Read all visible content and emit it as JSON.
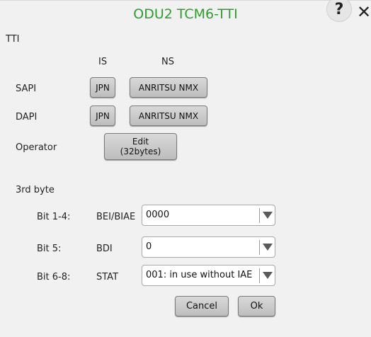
{
  "dialog": {
    "title": "ODU2 TCM6-TTI",
    "help_icon": "question-mark",
    "close_icon": "x"
  },
  "tti": {
    "section_label": "TTI",
    "col_is": "IS",
    "col_ns": "NS",
    "sapi": {
      "label": "SAPI",
      "is_value": "JPN",
      "ns_value": "ANRITSU NMX"
    },
    "dapi": {
      "label": "DAPI",
      "is_value": "JPN",
      "ns_value": "ANRITSU NMX"
    },
    "operator": {
      "label": "Operator",
      "button_line1": "Edit",
      "button_line2": "(32bytes)"
    }
  },
  "third_byte": {
    "section_label": "3rd byte",
    "rows": [
      {
        "bits": "Bit 1-4:",
        "name": "BEI/BIAE",
        "value": "0000"
      },
      {
        "bits": "Bit 5:",
        "name": "BDI",
        "value": "0"
      },
      {
        "bits": "Bit 6-8:",
        "name": "STAT",
        "value": "001: in use without IAE"
      }
    ]
  },
  "actions": {
    "cancel": "Cancel",
    "ok": "Ok"
  },
  "colors": {
    "title": "#2c9e2c",
    "panel": "#f1f1f1",
    "button": "#c8c8c8"
  }
}
